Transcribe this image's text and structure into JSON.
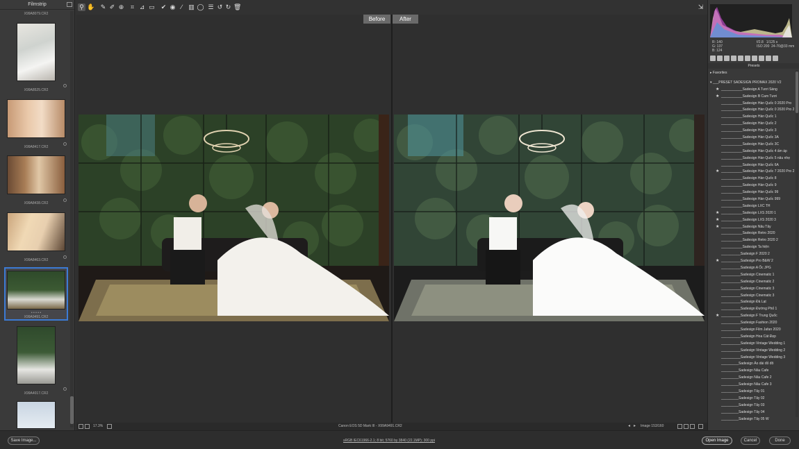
{
  "filmstrip": {
    "title": "Filmstrip",
    "labels": [
      "X99A8079.CR2",
      "X99A8525.CR2",
      "X99A8417.CR2",
      "X99A8438.CR2",
      "X99A8463.CR2",
      "X99A9491.CR2",
      "X99A4017.CR2"
    ],
    "rating": "• • • • •"
  },
  "compare": {
    "before": "Before",
    "after": "After"
  },
  "status": {
    "zoom": "17.3%",
    "camera_file": "Canon EOS 5D Mark III  -  X99A9491.CR2",
    "image_counter": "Image 153/160"
  },
  "info": {
    "r_label": "R:",
    "r_value": "140",
    "g_label": "G:",
    "g_value": "137",
    "b_label": "B:",
    "b_value": "124",
    "aperture": "f/2.8",
    "shutter": "1/125 s",
    "iso": "ISO 200",
    "lens": "24-70@33 mm"
  },
  "presets": {
    "title": "Presets",
    "favorites": "Favorites",
    "group": "___PRESET SADESIGN PROMAX 2020 V2",
    "items": [
      {
        "label": "___________Sadesign A Tươi Sáng",
        "star": true
      },
      {
        "label": "___________Sadesign B  Cam Tươi",
        "star": true
      },
      {
        "label": "___________Sadesign Hàn Quốc 0 2020 Pro",
        "star": false
      },
      {
        "label": "___________Sadesign Hàn Quốc 0 2020 Pro 2",
        "star": false
      },
      {
        "label": "___________Sadesign Hàn Quốc 1",
        "star": false
      },
      {
        "label": "___________Sadesign Hàn Quốc 2",
        "star": false
      },
      {
        "label": "___________Sadesign Hàn Quốc 3",
        "star": false
      },
      {
        "label": "___________Sadesign Hàn Quốc 3A",
        "star": false
      },
      {
        "label": "___________Sadesign Hàn Quốc 3C",
        "star": false
      },
      {
        "label": "___________Sadesign Hàn Quốc 4 ấm áp",
        "star": false
      },
      {
        "label": "___________Sadesign Hàn Quốc 5 nâu nhẹ",
        "star": false
      },
      {
        "label": "___________Sadesign Hàn Quốc 6A",
        "star": false
      },
      {
        "label": "___________Sadesign Hàn Quốc 7 2020 Pro 2",
        "star": true
      },
      {
        "label": "___________Sadesign Hàn Quốc 8",
        "star": false
      },
      {
        "label": "___________Sadesign Hàn Quốc 9",
        "star": false
      },
      {
        "label": "___________Sadesign Hàn Quốc 99",
        "star": false
      },
      {
        "label": "___________Sadesign Hàn Quốc 999",
        "star": false
      },
      {
        "label": "___________Sadesign LXC  TH",
        "star": false
      },
      {
        "label": "___________Sadesign LXS 2020 1",
        "star": true
      },
      {
        "label": "___________Sadesign LXS 2020 3",
        "star": true
      },
      {
        "label": "___________Sadesign Nâu Tây",
        "star": true
      },
      {
        "label": "___________Sadesign Retro 2020",
        "star": false
      },
      {
        "label": "___________Sadesign Retro 2020 2",
        "star": false
      },
      {
        "label": "___________Sadesign Ta hiện",
        "star": false
      },
      {
        "label": "__________Sadesign  F 2020 2",
        "star": false
      },
      {
        "label": "__________Sadesign  Pro B&W 2",
        "star": true
      },
      {
        "label": "__________Sadesign A Ốc JPG",
        "star": false
      },
      {
        "label": "__________Sadesign Cinematic 1",
        "star": false
      },
      {
        "label": "__________Sadesign Cinematic 2",
        "star": false
      },
      {
        "label": "__________Sadesign Cinematic 3",
        "star": false
      },
      {
        "label": "__________Sadesign Cinematic 3",
        "star": false
      },
      {
        "label": "__________Sadesign Đà Lạt",
        "star": false
      },
      {
        "label": "__________Sadesign Đường Phố 1",
        "star": false
      },
      {
        "label": "__________Sadesign F Trung Quốc",
        "star": true
      },
      {
        "label": "__________Sadesign Fashion 2020",
        "star": false
      },
      {
        "label": "__________Sadesign Film Jafan 2020",
        "star": false
      },
      {
        "label": "__________Sadesign Hoa Cát Đẹp",
        "star": false
      },
      {
        "label": "__________Sadesign Vintage Wedding 1",
        "star": false
      },
      {
        "label": "__________Sadesign Vintage Wedding 2",
        "star": false
      },
      {
        "label": "__________Sadesign Vintage Wedding 3",
        "star": false
      },
      {
        "label": "_________Sadesign Áo dài đỏ đô",
        "star": false
      },
      {
        "label": "_________Sadesign Nâu Cafe",
        "star": false
      },
      {
        "label": "_________Sadesign Nâu Cafe 2",
        "star": false
      },
      {
        "label": "_________Sadesign Nâu Cafe 3",
        "star": false
      },
      {
        "label": "_________Sadesign Tây 01",
        "star": false
      },
      {
        "label": "_________Sadesign Tây 02",
        "star": false
      },
      {
        "label": "_________Sadesign Tây 03",
        "star": false
      },
      {
        "label": "_________Sadesign Tây 04",
        "star": false
      },
      {
        "label": "_________Sadesign Tây 05 W",
        "star": false
      }
    ]
  },
  "bottom": {
    "save_image": "Save Image...",
    "workflow": "sRGB IEC61966-2.1; 8 bit; 5760 by 3840 (22.1MP); 300 ppi",
    "open_image": "Open Image",
    "cancel": "Cancel",
    "done": "Done"
  }
}
